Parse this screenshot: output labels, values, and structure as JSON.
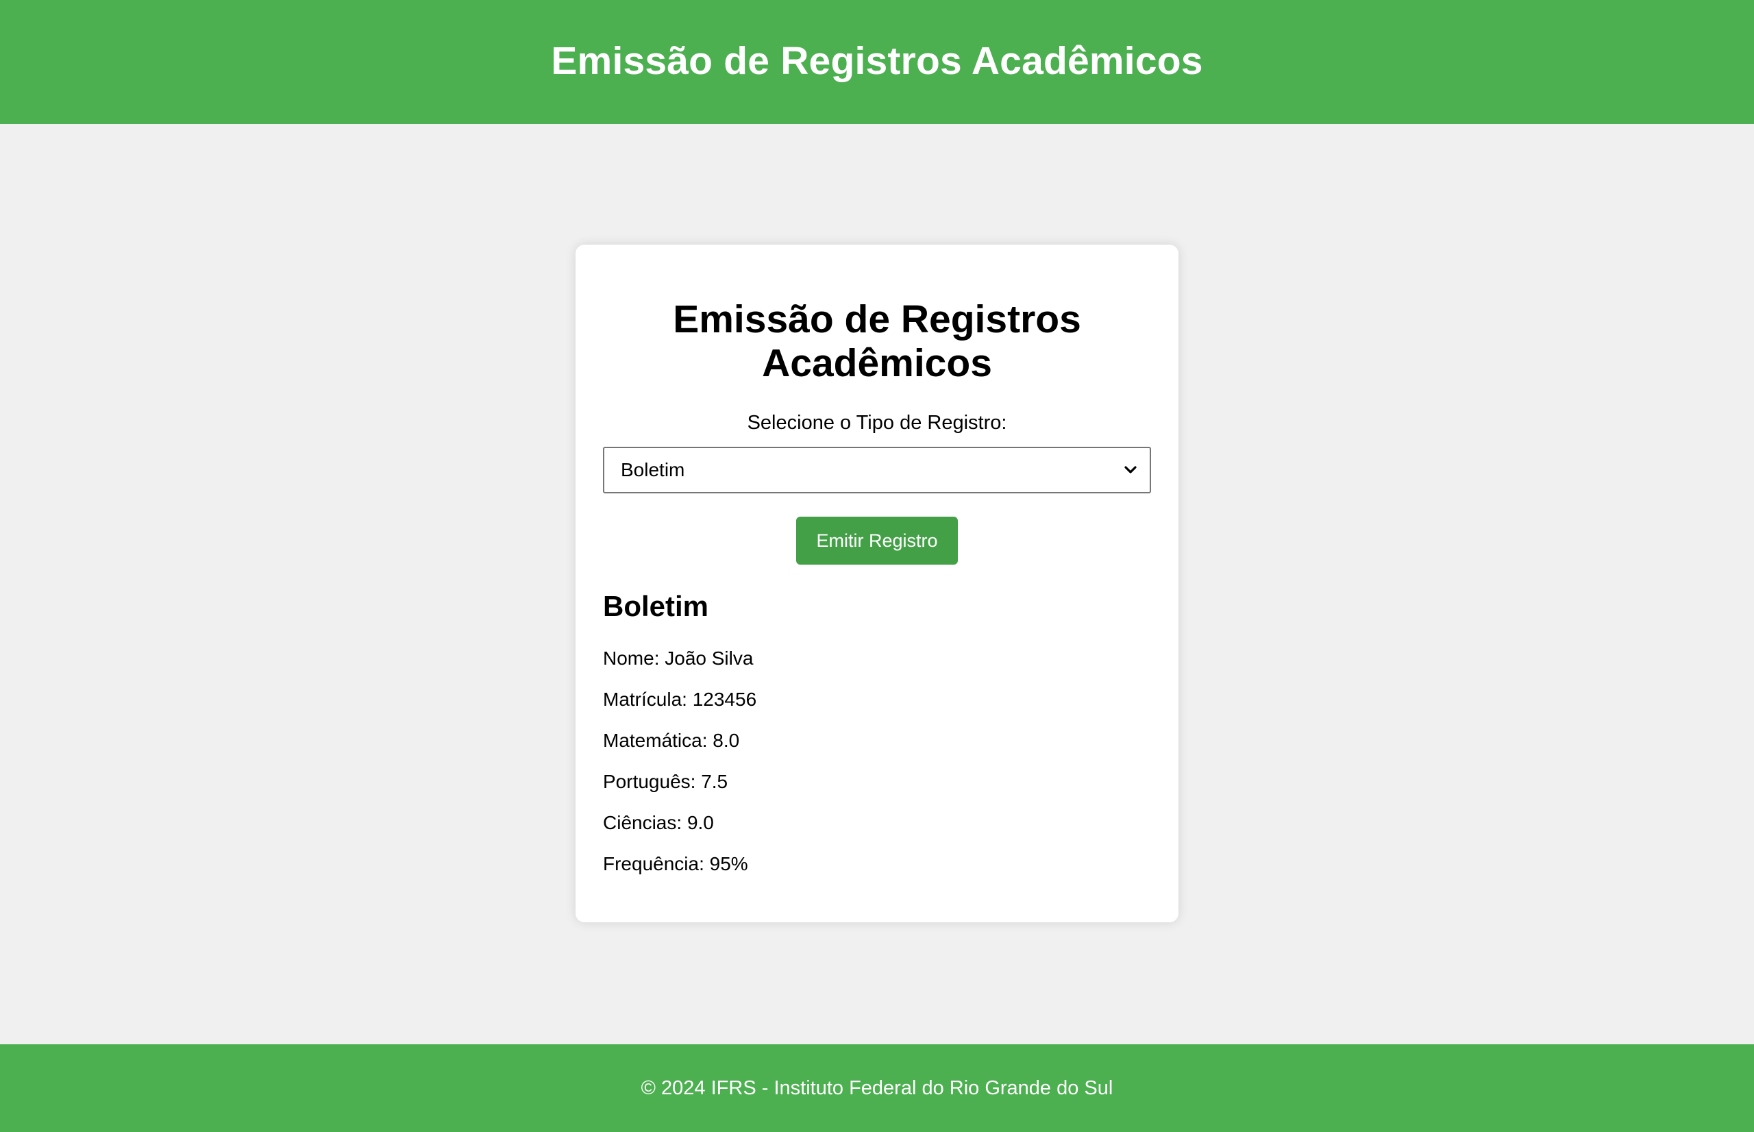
{
  "header": {
    "title": "Emissão de Registros Acadêmicos"
  },
  "card": {
    "title": "Emissão de Registros Acadêmicos",
    "select_label": "Selecione o Tipo de Registro:",
    "select_value": "Boletim",
    "emit_button_label": "Emitir Registro"
  },
  "record": {
    "title": "Boletim",
    "lines": [
      "Nome: João Silva",
      "Matrícula: 123456",
      "Matemática: 8.0",
      "Português: 7.5",
      "Ciências: 9.0",
      "Frequência: 95%"
    ]
  },
  "footer": {
    "text": "© 2024 IFRS - Instituto Federal do Rio Grande do Sul"
  },
  "colors": {
    "header_bg": "#4caf50",
    "button_bg": "#43a047",
    "page_bg": "#f0f0f0"
  },
  "icons": {
    "select_arrow": "chevron-down-icon"
  }
}
